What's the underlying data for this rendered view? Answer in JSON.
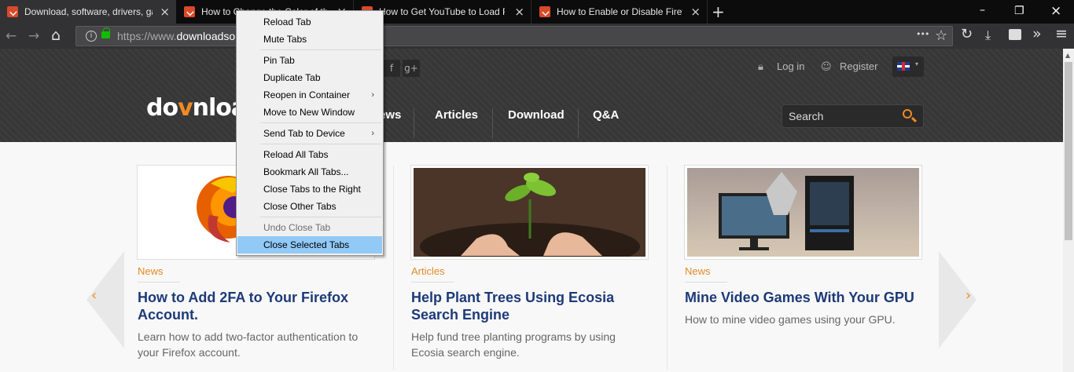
{
  "tabs": [
    {
      "title": "Download, software, drivers, games",
      "active": true
    },
    {
      "title": "How to Change the Color of the",
      "active": false
    },
    {
      "title": "How to Get YouTube to Load F",
      "active": false
    },
    {
      "title": "How to Enable or Disable Firefo",
      "active": false
    }
  ],
  "url": {
    "prefix": "https://www.",
    "domain": "downloadso"
  },
  "site": {
    "logo_left": "do",
    "logo_mid": "v",
    "logo_right": "nloa",
    "nav": [
      "ews",
      "Articles",
      "Download",
      "Q&A"
    ],
    "social": [
      "f",
      "g+"
    ],
    "login": "Log in",
    "register": "Register",
    "search_placeholder": "Search"
  },
  "cards": [
    {
      "category": "News",
      "title": "How to Add 2FA to Your Firefox Account.",
      "desc": "Learn how to add two-factor authentication to your Firefox account."
    },
    {
      "category": "Articles",
      "title": "Help Plant Trees Using Ecosia Search Engine",
      "desc": "Help fund tree planting programs by using Ecosia search engine."
    },
    {
      "category": "News",
      "title": "Mine Video Games With Your GPU",
      "desc": "How to mine video games using your GPU."
    }
  ],
  "context_menu": [
    {
      "label": "Reload Tab"
    },
    {
      "label": "Mute Tabs"
    },
    {
      "label": "Pin Tab"
    },
    {
      "label": "Duplicate Tab"
    },
    {
      "label": "Reopen in Container",
      "submenu": true
    },
    {
      "label": "Move to New Window"
    },
    {
      "label": "Send Tab to Device",
      "submenu": true
    },
    {
      "label": "Reload All Tabs"
    },
    {
      "label": "Bookmark All Tabs..."
    },
    {
      "label": "Close Tabs to the Right"
    },
    {
      "label": "Close Other Tabs"
    },
    {
      "label": "Undo Close Tab",
      "disabled": true
    },
    {
      "label": "Close Selected Tabs",
      "highlighted": true
    }
  ],
  "icons": {
    "close": "×",
    "new_tab": "+",
    "back": "←",
    "forward": "→",
    "home": "⌂",
    "more": "•••",
    "bookmark": "☆",
    "reload": "↻",
    "overflow": "»",
    "menu": "≡",
    "submenu_arrow": "›",
    "chevron_left": "‹",
    "chevron_right": "›"
  },
  "colors": {
    "accent": "#f08a24",
    "title_blue": "#1d3a78",
    "menu_highlight": "#91c9f7"
  }
}
